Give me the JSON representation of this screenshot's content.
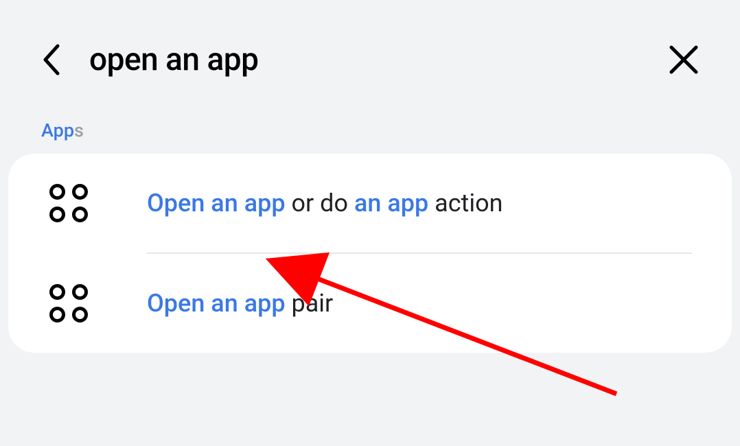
{
  "header": {
    "search_query": "open an app"
  },
  "section": {
    "label_highlight": "App",
    "label_rest": "s"
  },
  "results": [
    {
      "parts": [
        {
          "text": "Open an app",
          "hl": true
        },
        {
          "text": " or do ",
          "hl": false
        },
        {
          "text": "an app",
          "hl": true
        },
        {
          "text": " action",
          "hl": false
        }
      ]
    },
    {
      "parts": [
        {
          "text": "Open an app",
          "hl": true
        },
        {
          "text": " pair",
          "hl": false
        }
      ]
    }
  ],
  "icons": {
    "back": "back-icon",
    "close": "close-icon",
    "apps": "apps-grid-icon"
  }
}
